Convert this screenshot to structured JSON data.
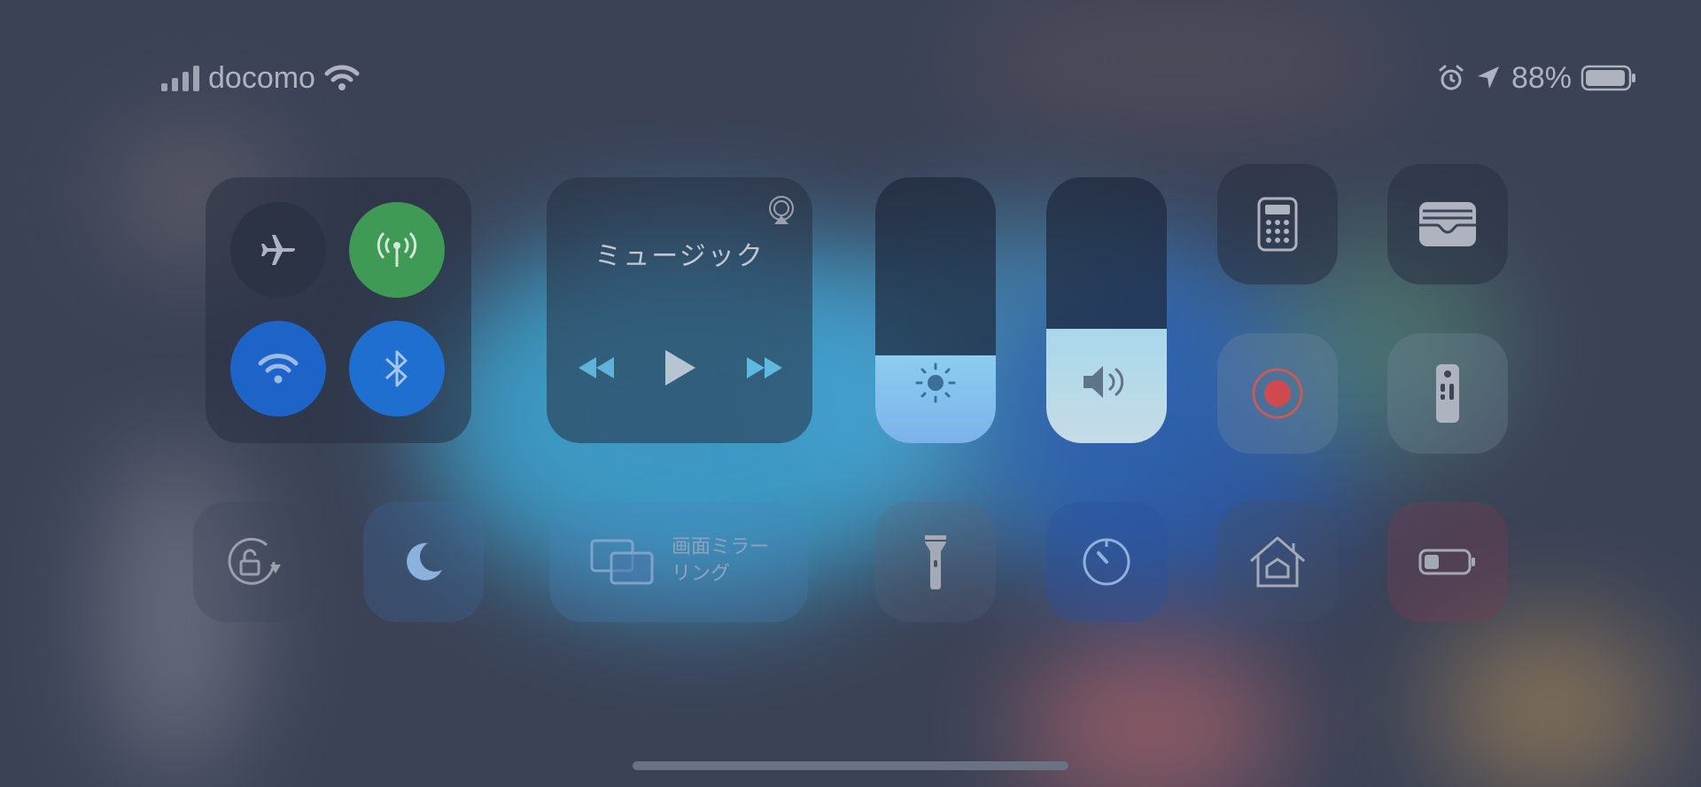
{
  "status_bar": {
    "carrier": "docomo",
    "battery_percent": "88%",
    "battery_level": 0.88,
    "icons": [
      "cellular-signal-icon",
      "wifi-icon",
      "alarm-icon",
      "location-arrow-icon",
      "battery-icon"
    ]
  },
  "connectivity": {
    "airplane_mode": false,
    "cellular_data": true,
    "wifi": true,
    "bluetooth": true,
    "colors": {
      "cellular": "#3e9a55",
      "wifi": "#1e64c8",
      "bluetooth": "#1e6fd0",
      "off": "#2c3344"
    }
  },
  "music": {
    "title": "ミュージック",
    "controls": [
      "rewind-icon",
      "play-icon",
      "fast-forward-icon"
    ]
  },
  "brightness": {
    "level": 0.33
  },
  "volume": {
    "level": 0.43
  },
  "shortcuts": {
    "calculator": "calculator-icon",
    "wallet": "wallet-icon",
    "screen_record": "screen-record-icon",
    "remote": "apple-tv-remote-icon",
    "rotation_lock": "rotation-lock-icon",
    "do_not_disturb": "moon-icon",
    "flashlight": "flashlight-icon",
    "timer": "timer-icon",
    "home": "home-icon",
    "low_power": "low-power-mode-icon"
  },
  "screen_mirroring": {
    "label_line1": "画面ミラー",
    "label_line2": "リング"
  }
}
